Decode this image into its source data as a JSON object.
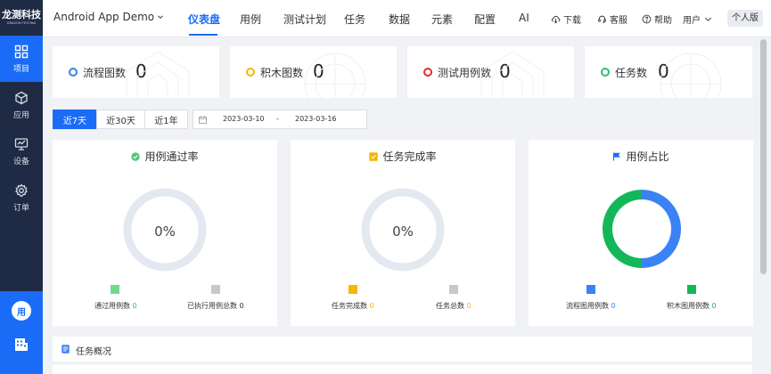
{
  "sidebar": {
    "logo_main": "龙测科技",
    "logo_sub": "DRAGON TESTING",
    "items": [
      {
        "label": "项目",
        "icon": "grid-icon",
        "active": true
      },
      {
        "label": "应用",
        "icon": "cube-icon",
        "active": false
      },
      {
        "label": "设备",
        "icon": "monitor-icon",
        "active": false
      },
      {
        "label": "订单",
        "icon": "gear-icon",
        "active": false
      }
    ],
    "avatar_text": "用"
  },
  "header": {
    "app_name": "Android App Demo",
    "nav": [
      "仪表盘",
      "用例",
      "测试计划",
      "任务",
      "数据",
      "元素",
      "配置",
      "AI"
    ],
    "active_nav": "仪表盘",
    "tools": [
      {
        "label": "下载",
        "icon": "cloud-download-icon"
      },
      {
        "label": "客服",
        "icon": "headset-icon"
      },
      {
        "label": "帮助",
        "icon": "help-icon"
      },
      {
        "label": "用户",
        "icon": "chevron-down-icon"
      }
    ],
    "edition": "个人版"
  },
  "stats": [
    {
      "name": "流程图数",
      "value": "0",
      "color": "#3b82e0"
    },
    {
      "name": "积木图数",
      "value": "0",
      "color": "#f5b800"
    },
    {
      "name": "测试用例数",
      "value": "0",
      "color": "#e02b2b"
    },
    {
      "name": "任务数",
      "value": "0",
      "color": "#2ec06b"
    }
  ],
  "filter": {
    "ranges": [
      "近7天",
      "近30天",
      "近1年"
    ],
    "active_range": "近7天",
    "start_date": "2023-03-10",
    "separator": "-",
    "end_date": "2023-03-16"
  },
  "panels": [
    {
      "title": "用例通过率",
      "icon": "check-circle-icon",
      "center_text": "0%",
      "legend": [
        {
          "label": "通过用例数",
          "value": "0",
          "color": "#6fdc8c",
          "value_color": "#2ec06b"
        },
        {
          "label": "已执行用例总数",
          "value": "0",
          "color": "#c8c8c8",
          "value_color": "#333333"
        }
      ]
    },
    {
      "title": "任务完成率",
      "icon": "checkbox-icon",
      "center_text": "0%",
      "legend": [
        {
          "label": "任务完成数",
          "value": "0",
          "color": "#f5b800",
          "value_color": "#f5b800"
        },
        {
          "label": "任务总数",
          "value": "0",
          "color": "#c8c8c8",
          "value_color": "#f5b800"
        }
      ]
    },
    {
      "title": "用例占比",
      "icon": "flag-icon",
      "legend": [
        {
          "label": "流程图用例数",
          "value": "0",
          "color": "#3b82f6",
          "value_color": "#3b82f6"
        },
        {
          "label": "积木图用例数",
          "value": "0",
          "color": "#13b75a",
          "value_color": "#13b75a"
        }
      ]
    }
  ],
  "chart_data": {
    "type": "pie",
    "title": "用例占比",
    "categories": [
      "流程图用例数",
      "积木图用例数"
    ],
    "values": [
      0,
      0
    ],
    "display_split": [
      50,
      50
    ],
    "colors": [
      "#3b82f6",
      "#13b75a"
    ]
  },
  "overview": {
    "title": "任务概况",
    "icon": "document-icon"
  }
}
